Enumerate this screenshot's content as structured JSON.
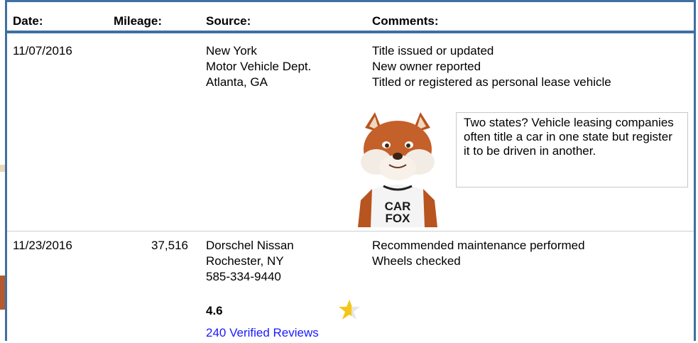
{
  "header": {
    "date": "Date:",
    "mileage": "Mileage:",
    "source": "Source:",
    "comments": "Comments:"
  },
  "records": [
    {
      "date": "11/07/2016",
      "mileage": "",
      "source": [
        "New York",
        "Motor Vehicle Dept.",
        "Atlanta, GA"
      ],
      "comments": [
        "Title issued or updated",
        "New owner reported",
        "Titled or registered as personal lease vehicle"
      ]
    },
    {
      "date": "11/23/2016",
      "mileage": "37,516",
      "source": [
        "Dorschel Nissan",
        "Rochester, NY",
        "585-334-9440"
      ],
      "comments": [
        "Recommended maintenance performed",
        "Wheels checked"
      ]
    }
  ],
  "callout": {
    "text": "Two states? Vehicle leasing companies often title a car in one state but register it to be driven in another."
  },
  "mascot": {
    "shirt_line1": "CAR",
    "shirt_line2": "FOX"
  },
  "dealer_rating": {
    "score": "4.6",
    "reviews_link": "240 Verified Reviews",
    "star_fill": 0.6,
    "star_color": "#f5c518"
  },
  "colors": {
    "frame_blue": "#3f6fa3",
    "link_blue": "#1a1aff"
  }
}
